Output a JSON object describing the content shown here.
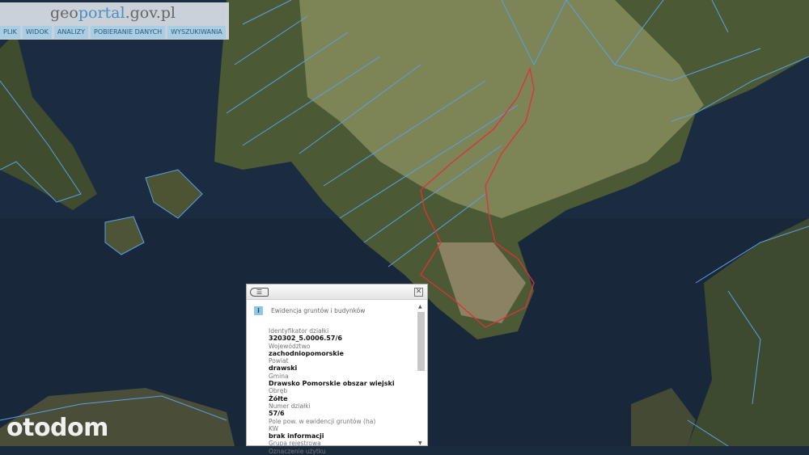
{
  "header": {
    "logo_prefix": "geo",
    "logo_portal": "portal",
    "logo_suffix": ".gov.pl",
    "menu": [
      "PLIK",
      "WIDOK",
      "ANALIZY",
      "POBIERANIE DANYCH",
      "WYSZUKIWANIA"
    ]
  },
  "popup": {
    "title": "Ewidencja gruntów i budynków",
    "back_icon": "list-back-icon",
    "close_icon": "close-icon",
    "fields": [
      {
        "label": "Identyfikator działki",
        "value": "320302_5.0006.57/6"
      },
      {
        "label": "Województwo",
        "value": "zachodniopomorskie"
      },
      {
        "label": "Powiat",
        "value": "drawski"
      },
      {
        "label": "Gmina",
        "value": "Drawsko Pomorskie obszar wiejski"
      },
      {
        "label": "Obręb",
        "value": "Żółte"
      },
      {
        "label": "Numer działki",
        "value": "57/6"
      },
      {
        "label": "Pole pow. w ewidencji gruntów (ha)",
        "value": ""
      },
      {
        "label": "KW",
        "value": "brak informacji"
      },
      {
        "label": "Grupa rejestrowa",
        "value": ""
      },
      {
        "label": "Oznaczenie użytku",
        "value": ""
      }
    ]
  },
  "watermark": "otodom",
  "colors": {
    "water": "#1b2b3e",
    "parcel": "#5aa0e8",
    "selected": "#e0303a"
  }
}
